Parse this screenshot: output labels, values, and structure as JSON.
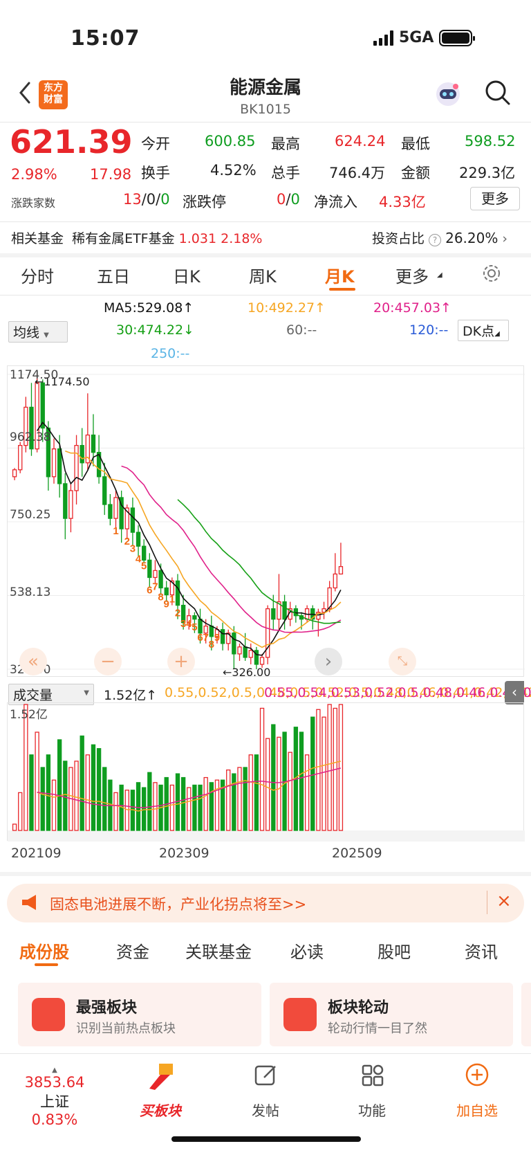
{
  "status": {
    "time": "15:07",
    "network": "5GA"
  },
  "header": {
    "title": "能源金属",
    "code": "BK1015",
    "logo_line1": "东方",
    "logo_line2": "财富"
  },
  "quote": {
    "price": "621.39",
    "change_pct": "2.98%",
    "change": "17.98",
    "open_label": "今开",
    "open": "600.85",
    "high_label": "最高",
    "high": "624.24",
    "low_label": "最低",
    "low": "598.52",
    "turnover_label": "换手",
    "turnover": "4.52%",
    "volume_label": "总手",
    "volume": "746.4万",
    "amount_label": "金额",
    "amount": "229.3亿",
    "breadth_label": "涨跌家数",
    "breadth_up": "13",
    "breadth_sep1": "/0/",
    "breadth_down": "0",
    "limit_label": "涨跌停",
    "limit_up": "0",
    "limit_sep": "/",
    "limit_down": "0",
    "inflow_label": "净流入",
    "inflow": "4.33亿",
    "more_label": "更多"
  },
  "fund": {
    "label": "相关基金",
    "name": "稀有金属ETF基金",
    "price": "1.031",
    "pct": "2.18%",
    "invest_label": "投资占比",
    "invest": "26.20%"
  },
  "period_tabs": [
    "分时",
    "五日",
    "日K",
    "周K",
    "月K",
    "更多"
  ],
  "active_period": "月K",
  "ma": {
    "selector": "均线",
    "ma5": "MA5:529.08↑",
    "ma10": "10:492.27↑",
    "ma20": "20:457.03↑",
    "ma30": "30:474.22↓",
    "ma60": "60:--",
    "ma120": "120:--",
    "ma250": "250:--",
    "dk": "DK点"
  },
  "colors": {
    "up": "#e8262a",
    "down": "#0f9d20",
    "accent": "#f16a12",
    "ma5": "#111111",
    "ma10": "#f6a623",
    "ma20": "#e0218a",
    "ma30": "#16a016"
  },
  "chart_data": {
    "type": "candlestick",
    "period": "monthly",
    "y_ticks": [
      "1174.50",
      "962.38",
      "750.25",
      "538.13",
      "326.00"
    ],
    "ylim": [
      326.0,
      1174.5
    ],
    "max_label": "1174.50",
    "min_label": "326.00",
    "x_labels": [
      "202109",
      "202309",
      "202509"
    ],
    "candles": [
      [
        880,
        900,
        905,
        870
      ],
      [
        900,
        970,
        980,
        890
      ],
      [
        970,
        1080,
        1110,
        950
      ],
      [
        1080,
        960,
        1150,
        940
      ],
      [
        960,
        1150,
        1174.5,
        950
      ],
      [
        1150,
        1020,
        1160,
        980
      ],
      [
        1020,
        880,
        1040,
        840
      ],
      [
        880,
        960,
        990,
        860
      ],
      [
        960,
        860,
        1000,
        820
      ],
      [
        860,
        760,
        890,
        700
      ],
      [
        760,
        840,
        860,
        720
      ],
      [
        840,
        970,
        1000,
        800
      ],
      [
        970,
        920,
        1020,
        880
      ],
      [
        920,
        1000,
        1120,
        900
      ],
      [
        1000,
        950,
        1060,
        910
      ],
      [
        950,
        880,
        1000,
        860
      ],
      [
        880,
        800,
        920,
        770
      ],
      [
        800,
        760,
        830,
        740
      ],
      [
        760,
        820,
        840,
        730
      ],
      [
        820,
        730,
        840,
        690
      ],
      [
        730,
        790,
        800,
        700
      ],
      [
        790,
        720,
        820,
        680
      ],
      [
        720,
        680,
        740,
        650
      ],
      [
        680,
        640,
        700,
        630
      ],
      [
        640,
        590,
        660,
        560
      ],
      [
        590,
        610,
        640,
        570
      ],
      [
        610,
        560,
        630,
        540
      ],
      [
        560,
        540,
        580,
        520
      ],
      [
        540,
        580,
        590,
        510
      ],
      [
        580,
        510,
        600,
        470
      ],
      [
        510,
        460,
        540,
        440
      ],
      [
        460,
        480,
        500,
        440
      ],
      [
        480,
        470,
        490,
        430
      ],
      [
        470,
        430,
        500,
        400
      ],
      [
        430,
        450,
        470,
        400
      ],
      [
        450,
        420,
        480,
        380
      ],
      [
        420,
        440,
        450,
        400
      ],
      [
        440,
        400,
        460,
        380
      ],
      [
        400,
        430,
        440,
        380
      ],
      [
        430,
        370,
        450,
        326
      ],
      [
        370,
        390,
        400,
        350
      ],
      [
        390,
        360,
        430,
        350
      ],
      [
        360,
        380,
        400,
        340
      ],
      [
        380,
        340,
        390,
        326
      ],
      [
        340,
        360,
        370,
        330
      ],
      [
        360,
        500,
        510,
        340
      ],
      [
        500,
        470,
        540,
        440
      ],
      [
        470,
        520,
        600,
        440
      ],
      [
        520,
        470,
        540,
        440
      ],
      [
        470,
        500,
        520,
        450
      ],
      [
        500,
        480,
        510,
        460
      ],
      [
        480,
        470,
        490,
        440
      ],
      [
        470,
        500,
        510,
        460
      ],
      [
        500,
        470,
        510,
        440
      ],
      [
        470,
        490,
        500,
        420
      ],
      [
        490,
        500,
        520,
        470
      ],
      [
        500,
        560,
        580,
        490
      ],
      [
        560,
        600,
        660,
        550
      ],
      [
        600,
        621.39,
        690,
        598.52
      ]
    ],
    "sequence_marks": [
      "1",
      "2",
      "3",
      "4",
      "5",
      "6",
      "7",
      "8",
      "9",
      "1",
      "2",
      "3",
      "4",
      "5",
      "6",
      "7",
      "8",
      "9"
    ]
  },
  "volume": {
    "selector": "成交量",
    "value": "1.52亿↑",
    "ma1": [
      0.55,
      0.52,
      0.5,
      0.48,
      0.5,
      0.52,
      0.5,
      0.48,
      0.46,
      0.44,
      0.42,
      0.42,
      0.4,
      0.38,
      0.36,
      0.34,
      0.3,
      0.3,
      0.28,
      0.3,
      0.3,
      0.31,
      0.33,
      0.35,
      0.37,
      0.38,
      0.4,
      0.42,
      0.44,
      0.46,
      0.5,
      0.56,
      0.6,
      0.62,
      0.65,
      0.68,
      0.7,
      0.72,
      0.7,
      0.68,
      0.66,
      0.62,
      0.58,
      0.6,
      0.68,
      0.72,
      0.76,
      0.82,
      0.86,
      0.9,
      0.92,
      0.94,
      0.96,
      0.98,
      1.0
    ],
    "ma2": [
      0.55,
      0.54,
      0.53,
      0.52,
      0.5,
      0.48,
      0.46,
      0.44,
      0.42,
      0.4,
      0.38,
      0.37,
      0.36,
      0.36,
      0.36,
      0.36,
      0.35,
      0.34,
      0.33,
      0.33,
      0.34,
      0.35,
      0.36,
      0.38,
      0.4,
      0.42,
      0.44,
      0.46,
      0.48,
      0.5,
      0.52,
      0.55,
      0.58,
      0.61,
      0.64,
      0.66,
      0.68,
      0.69,
      0.7,
      0.71,
      0.71,
      0.7,
      0.69,
      0.69,
      0.7,
      0.72,
      0.74,
      0.76,
      0.78,
      0.8,
      0.82,
      0.84,
      0.86,
      0.88,
      0.9
    ],
    "max_label": "1.52亿",
    "series": [
      0.05,
      0.3,
      1.0,
      0.6,
      0.78,
      0.5,
      0.6,
      0.4,
      0.72,
      0.55,
      0.5,
      0.55,
      0.75,
      0.6,
      0.68,
      0.65,
      0.5,
      0.4,
      0.3,
      0.36,
      0.32,
      0.32,
      0.38,
      0.34,
      0.46,
      0.38,
      0.36,
      0.42,
      0.36,
      0.45,
      0.42,
      0.34,
      0.36,
      0.36,
      0.42,
      0.38,
      0.4,
      0.4,
      0.48,
      0.45,
      0.5,
      0.5,
      0.6,
      0.6,
      0.97,
      0.73,
      0.84,
      0.74,
      0.78,
      0.62,
      0.82,
      0.78,
      0.6,
      0.9,
      0.96,
      0.9,
      1.0,
      0.97,
      1.0
    ]
  },
  "banner": {
    "text": "固态电池进展不断，产业化拐点将至>>"
  },
  "content_tabs": [
    "成份股",
    "资金",
    "关联基金",
    "必读",
    "股吧",
    "资讯"
  ],
  "active_content_tab": "成份股",
  "cards": [
    {
      "title": "最强板块",
      "sub": "识别当前热点板块"
    },
    {
      "title": "板块轮动",
      "sub": "轮动行情一目了然"
    }
  ],
  "bottom": {
    "index_value": "3853.64",
    "index_name": "上证",
    "index_pct": "0.83%",
    "items": [
      "买板块",
      "发帖",
      "功能",
      "加自选"
    ]
  }
}
